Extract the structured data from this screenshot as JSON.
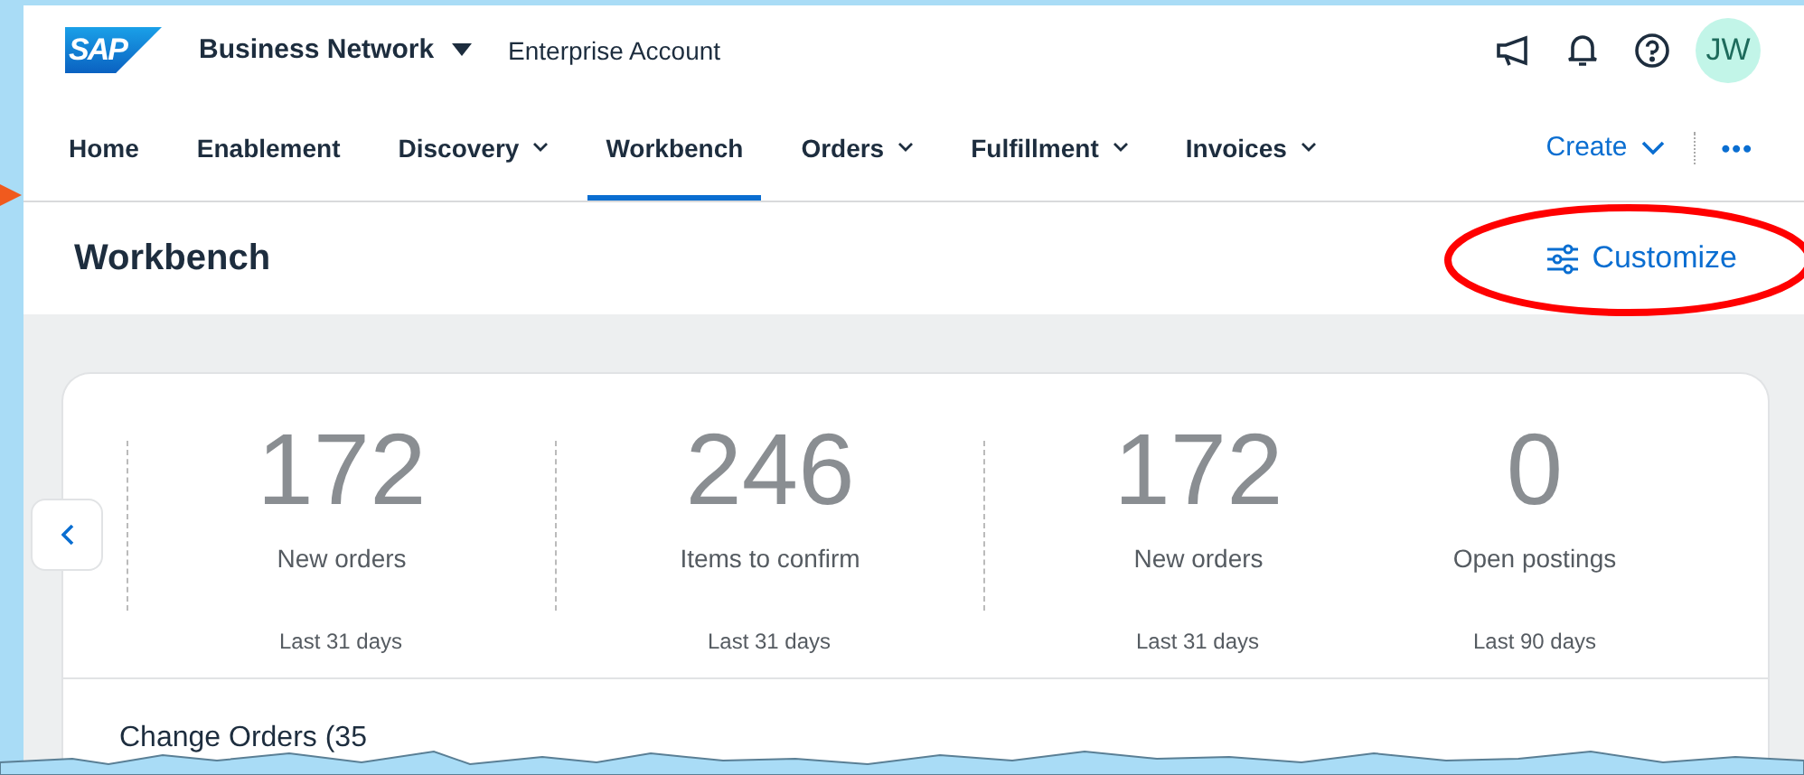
{
  "header": {
    "logo": "SAP",
    "product": "Business Network",
    "account": "Enterprise Account",
    "avatar": "JW"
  },
  "nav": {
    "items": [
      {
        "label": "Home",
        "has_menu": false,
        "selected": false
      },
      {
        "label": "Enablement",
        "has_menu": false,
        "selected": false
      },
      {
        "label": "Discovery",
        "has_menu": true,
        "selected": false
      },
      {
        "label": "Workbench",
        "has_menu": false,
        "selected": true
      },
      {
        "label": "Orders",
        "has_menu": true,
        "selected": false
      },
      {
        "label": "Fulfillment",
        "has_menu": true,
        "selected": false
      },
      {
        "label": "Invoices",
        "has_menu": true,
        "selected": false
      }
    ],
    "create": "Create",
    "more": "•••"
  },
  "page": {
    "title": "Workbench",
    "customize": "Customize"
  },
  "kpis": [
    {
      "value": "172",
      "label": "New orders",
      "period": "Last 31 days"
    },
    {
      "value": "246",
      "label": "Items to confirm",
      "period": "Last 31 days"
    },
    {
      "value": "172",
      "label": "New orders",
      "period": "Last 31 days"
    },
    {
      "value": "0",
      "label": "Open postings",
      "period": "Last 90 days"
    }
  ],
  "section": {
    "title": "Change Orders (35"
  }
}
